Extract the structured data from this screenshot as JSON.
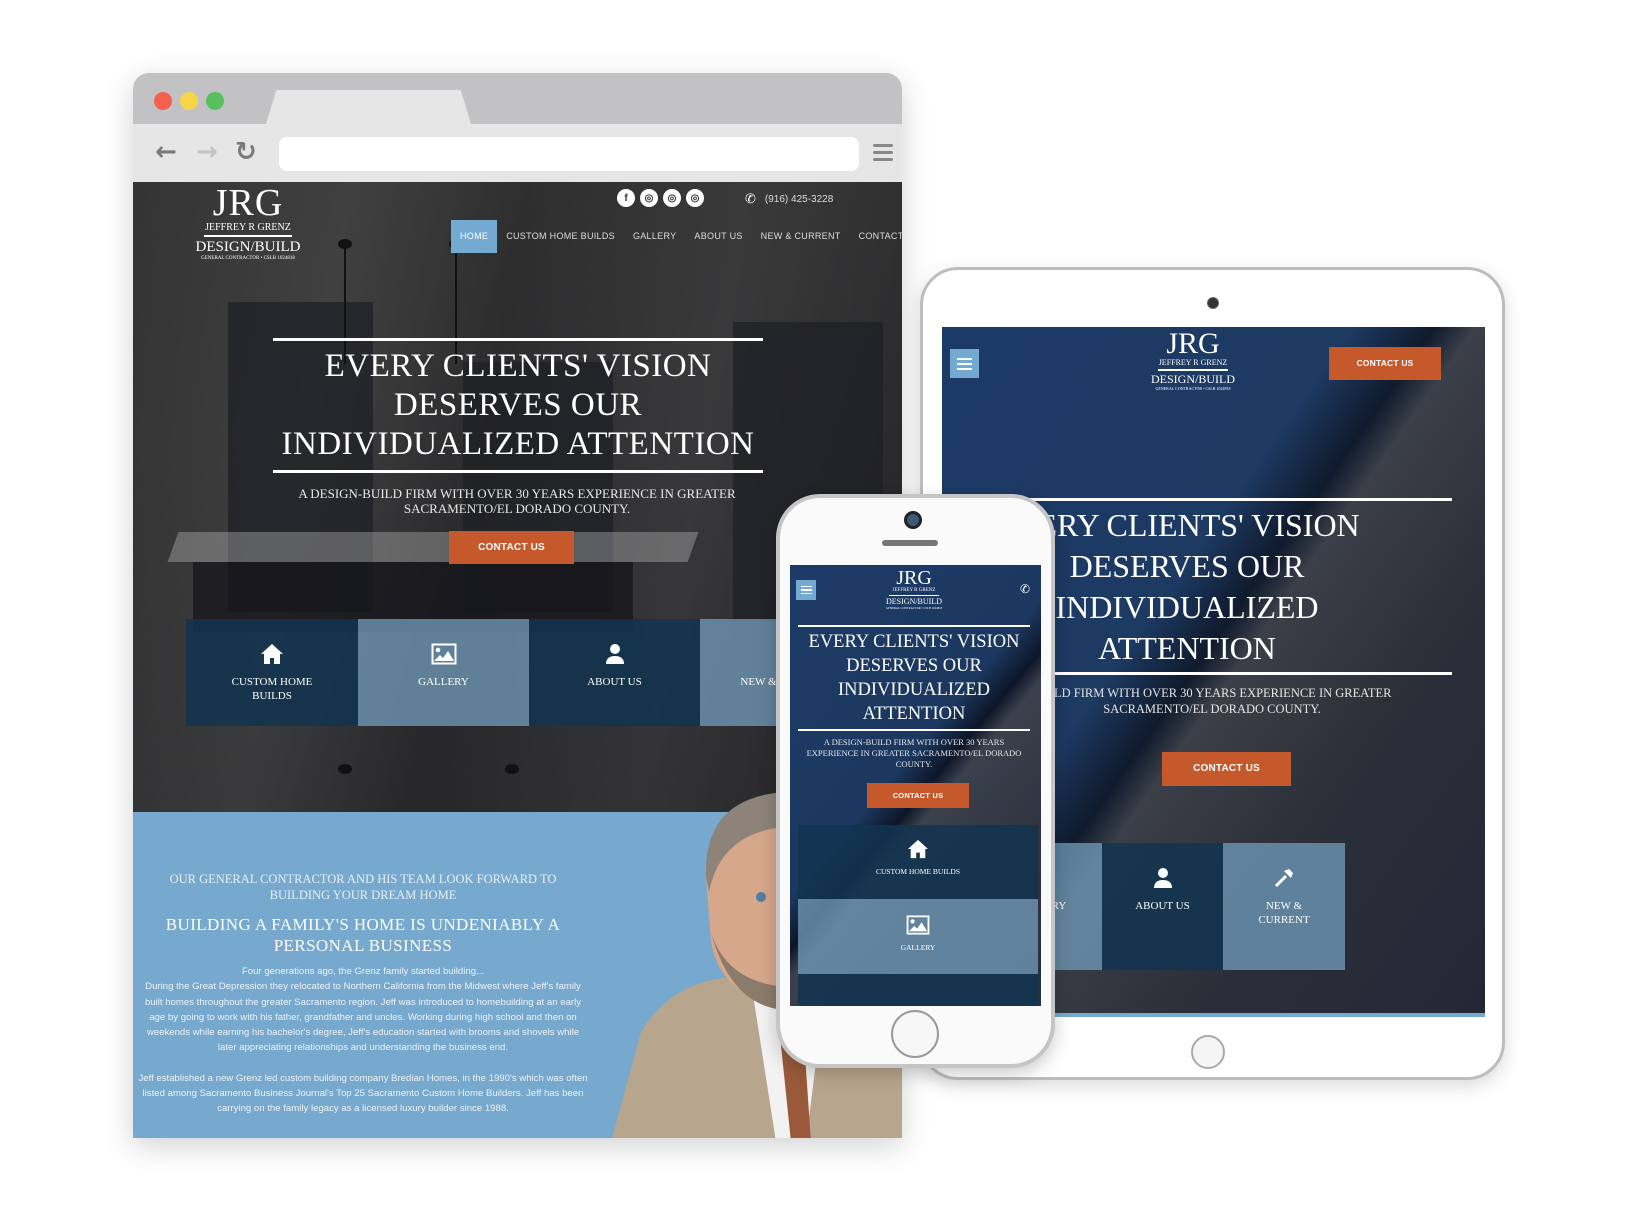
{
  "browser": {
    "window_controls": [
      {
        "name": "close",
        "color": "#f3604e"
      },
      {
        "name": "minimize",
        "color": "#f6d549"
      },
      {
        "name": "maximize",
        "color": "#57bf5d"
      }
    ],
    "back_icon": "←",
    "forward_icon": "→",
    "reload_icon": "↻",
    "url": ""
  },
  "brand": {
    "monogram": "JRG",
    "name": "JEFFREY R GRENZ",
    "tagline": "DESIGN/BUILD",
    "license": "GENERAL CONTRACTOR • CSLB 1024818"
  },
  "header": {
    "social": [
      {
        "name": "facebook",
        "glyph": "f"
      },
      {
        "name": "instagram",
        "glyph": "◎"
      },
      {
        "name": "instagram",
        "glyph": "◎"
      },
      {
        "name": "instagram",
        "glyph": "◎"
      }
    ],
    "phone_icon": "✆",
    "phone": "(916) 425-3228"
  },
  "nav": {
    "items": [
      "HOME",
      "CUSTOM HOME BUILDS",
      "GALLERY",
      "ABOUT US",
      "NEW & CURRENT",
      "CONTACT"
    ],
    "active": "HOME"
  },
  "hero": {
    "headline": "EVERY CLIENTS' VISION DESERVES OUR INDIVIDUALIZED ATTENTION",
    "subline": "A DESIGN-BUILD FIRM WITH OVER 30 YEARS EXPERIENCE IN GREATER SACRAMENTO/EL DORADO COUNTY.",
    "cta": "CONTACT US"
  },
  "tiles": [
    {
      "label": "CUSTOM HOME BUILDS",
      "icon": "home-icon"
    },
    {
      "label": "GALLERY",
      "icon": "image-icon"
    },
    {
      "label": "ABOUT US",
      "icon": "user-icon"
    },
    {
      "label": "NEW & CURRENT",
      "icon": "hammer-icon"
    }
  ],
  "about": {
    "kicker": "OUR GENERAL CONTRACTOR AND HIS TEAM LOOK FORWARD TO BUILDING YOUR DREAM HOME",
    "heading": "BUILDING A FAMILY'S HOME IS UNDENIABLY A PERSONAL BUSINESS",
    "paragraphs": [
      "Four generations ago, the Grenz family started building...",
      "During the Great Depression they relocated to Northern California from the Midwest where Jeff's family built homes throughout the greater Sacramento region. Jeff was introduced to homebuilding at an early age by going to work with his father, grandfather and uncles. Working during high school and then on weekends while earning his bachelor's degree, Jeff's education started with brooms and shovels while later appreciating relationships and understanding the business end.",
      "Jeff established a new Grenz led custom building company Bredian Homes, in the 1990's which was often listed among Sacramento Business Journal's Top 25 Sacramento Custom Home Builders. Jeff has been carrying on the family legacy as a licensed luxury builder since 1988."
    ]
  },
  "tablet": {
    "cta_header": "CONTACT US",
    "headline_visible": "VERY CLIENTS' VISION DESERVES OUR INDIVIDUALIZED ATTENTION",
    "subline_visible": "BUILD FIRM WITH OVER 30 YEARS EXPERIENCE IN GREATER SACRAMENTO/EL DORADO COUNTY.",
    "cta": "CONTACT US",
    "tiles": [
      "GALLERY",
      "ABOUT US",
      "NEW & CURRENT"
    ]
  },
  "phone": {
    "headline": "EVERY CLIENTS' VISION DESERVES OUR INDIVIDUALIZED ATTENTION",
    "subline": "A DESIGN-BUILD FIRM WITH OVER 30 YEARS EXPERIENCE IN GREATER SACRAMENTO/EL DORADO COUNTY.",
    "cta": "CONTACT US",
    "tiles": [
      "CUSTOM HOME BUILDS",
      "GALLERY"
    ]
  },
  "colors": {
    "accent_blue": "#74a9d1",
    "cta_orange": "#c6592c",
    "tile_dark": "#123450",
    "tile_light": "#6e96b4",
    "about_bg": "#77a8cd"
  }
}
